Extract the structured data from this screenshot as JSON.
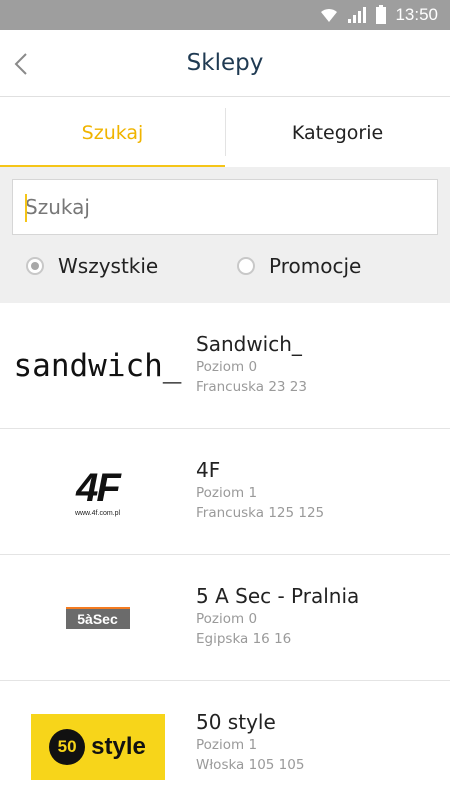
{
  "status_bar": {
    "time": "13:50"
  },
  "app_bar": {
    "title": "Sklepy"
  },
  "tabs": [
    {
      "label": "Szukaj",
      "active": true
    },
    {
      "label": "Kategorie",
      "active": false
    }
  ],
  "search": {
    "placeholder": "Szukaj",
    "value": ""
  },
  "filters": [
    {
      "label": "Wszystkie",
      "checked": true
    },
    {
      "label": "Promocje",
      "checked": false
    }
  ],
  "stores": [
    {
      "name": "Sandwich_",
      "level": "Poziom 0",
      "address": "Francuska 23 23",
      "logo_text": "sandwich_"
    },
    {
      "name": "4F",
      "level": "Poziom 1",
      "address": "Francuska 125 125",
      "logo_text": "4F",
      "logo_subtext": "www.4f.com.pl"
    },
    {
      "name": "5 A Sec - Pralnia",
      "level": "Poziom 0",
      "address": "Egipska 16 16",
      "logo_text": "5àSec"
    },
    {
      "name": "50 style",
      "level": "Poziom 1",
      "address": "Włoska 105 105",
      "logo_number": "50",
      "logo_text": "style"
    }
  ],
  "colors": {
    "accent": "#f5c518",
    "status_bar": "#9e9e9e",
    "title": "#1f3a52",
    "filter_bg": "#efefef"
  }
}
